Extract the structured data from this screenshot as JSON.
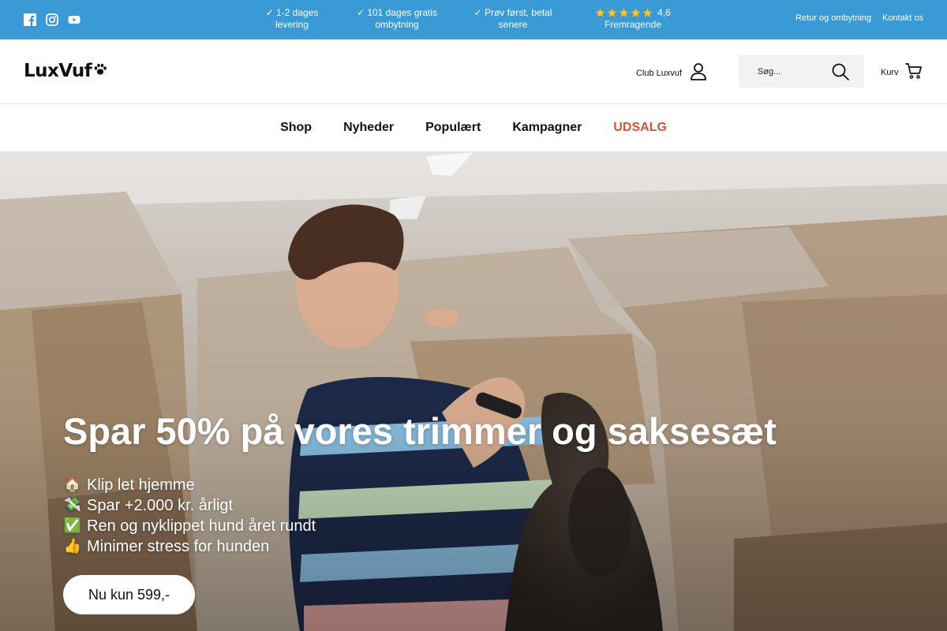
{
  "topbar": {
    "bg_color": "#3a9ad6",
    "social_icons": [
      "facebook-icon",
      "instagram-icon",
      "youtube-icon"
    ],
    "usps": [
      {
        "line1": "✓ 1-2 dages",
        "line2": "levering"
      },
      {
        "line1": "✓ 101 dages gratis",
        "line2": "ombytning"
      },
      {
        "line1": "✓ Prøv først, betal",
        "line2": "senere"
      }
    ],
    "rating": {
      "stars": 5,
      "score": "4,6",
      "label": "Fremragende"
    },
    "links": {
      "returns": "Retur og ombytning",
      "contact": "Kontakt os"
    }
  },
  "header": {
    "logo_text": "LuxVuf",
    "club_label": "Club Luxvuf",
    "search_placeholder": "Søg...",
    "cart_label": "Kurv"
  },
  "nav": {
    "items": [
      "Shop",
      "Nyheder",
      "Populært",
      "Kampagner"
    ],
    "sale_label": "UDSALG",
    "sale_color": "#d6523d"
  },
  "hero": {
    "title": "Spar 50% på vores trimmer og saksesæt",
    "bullets": [
      {
        "icon": "🏠",
        "text": "Klip let hjemme"
      },
      {
        "icon": "💸",
        "text": "Spar +2.000 kr. årligt"
      },
      {
        "icon": "✅",
        "text": "Ren og nyklippet hund året rundt"
      },
      {
        "icon": "👍",
        "text": "Minimer stress for hunden"
      }
    ],
    "cta_label": "Nu kun 599,-"
  }
}
